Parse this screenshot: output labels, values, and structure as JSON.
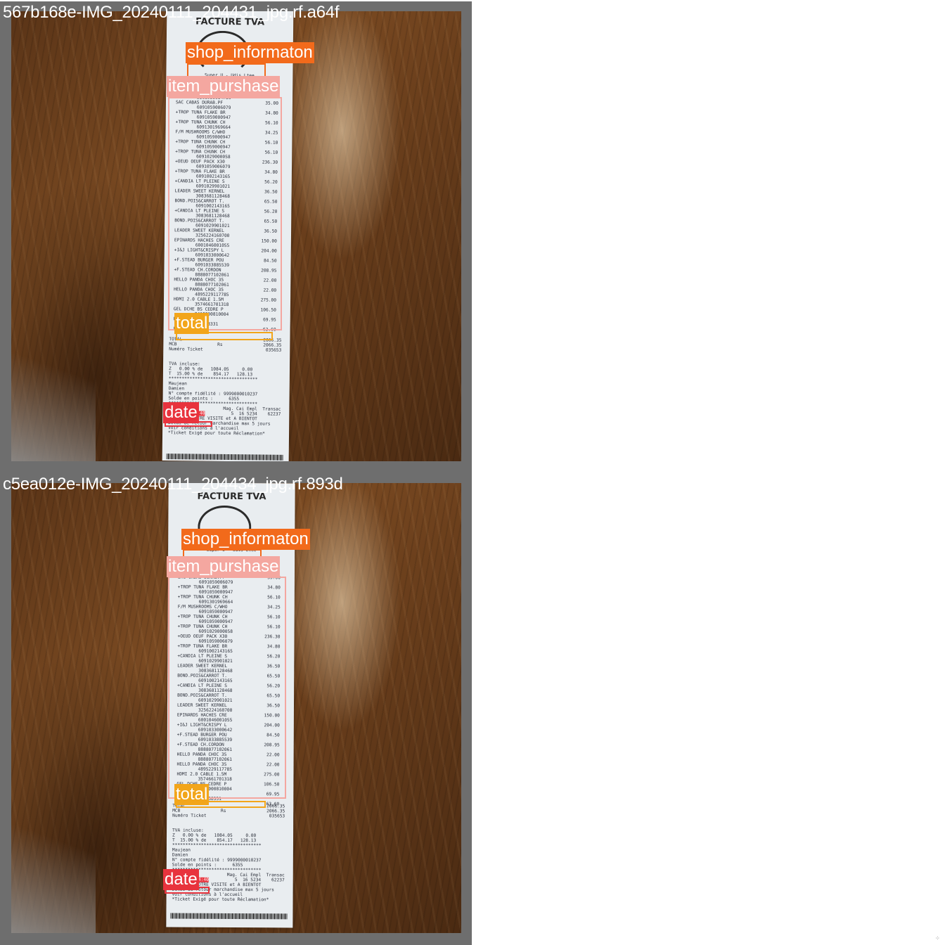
{
  "colors": {
    "shop_informaton": "#f26a1b",
    "item_purshase": "#f4a7a0",
    "total": "#f2a51a",
    "date": "#e8333d",
    "tile_border": "#6e6e6e"
  },
  "tiles": [
    {
      "caption": "567b168e-IMG_20240111_204431_jpg.rf.a64f",
      "boxes": {
        "shop_informaton": "shop_informaton",
        "item_purshase": "item_purshase",
        "total": "total",
        "date": "date"
      }
    },
    {
      "caption": "c5ea012e-IMG_20240111_204434_jpg.rf.893d",
      "boxes": {
        "shop_informaton": "shop_informaton",
        "item_purshase": "item_purshase",
        "total": "total",
        "date": "date"
      }
    }
  ],
  "receipt": {
    "title": "FACTURE TVA",
    "shop": "Super U - Udis Ltee",
    "items": [
      {
        "code": "3368950934736",
        "name": "",
        "price": ""
      },
      {
        "code": "",
        "name": "SAC CABAS DURAB.PF",
        "price": "35.00"
      },
      {
        "code": "6091059006079",
        "name": "",
        "price": ""
      },
      {
        "code": "",
        "name": "+TROP TUNA FLAKE BR",
        "price": "34.80"
      },
      {
        "code": "6091059000947",
        "name": "",
        "price": ""
      },
      {
        "code": "",
        "name": "+TROP TUNA CHUNK CH",
        "price": "56.10"
      },
      {
        "code": "6091301969664",
        "name": "",
        "price": ""
      },
      {
        "code": "",
        "name": "F/M MUSHROOMS C/WHO",
        "price": "34.25"
      },
      {
        "code": "6091059000947",
        "name": "",
        "price": ""
      },
      {
        "code": "",
        "name": "+TROP TUNA CHUNK CH",
        "price": "56.10"
      },
      {
        "code": "6091059000947",
        "name": "",
        "price": ""
      },
      {
        "code": "",
        "name": "+TROP TUNA CHUNK CH",
        "price": "56.10"
      },
      {
        "code": "6091029000058",
        "name": "",
        "price": ""
      },
      {
        "code": "",
        "name": "+OEUD OEUF PACK X30",
        "price": "236.30"
      },
      {
        "code": "6091059006079",
        "name": "",
        "price": ""
      },
      {
        "code": "",
        "name": "+TROP TUNA FLAKE BR",
        "price": "34.80"
      },
      {
        "code": "6091002143165",
        "name": "",
        "price": ""
      },
      {
        "code": "",
        "name": "+CANDIA LT PLEINE S",
        "price": "56.20"
      },
      {
        "code": "6091029901021",
        "name": "",
        "price": ""
      },
      {
        "code": "",
        "name": "LEADER SWEET KERNEL",
        "price": "36.50"
      },
      {
        "code": "3083681128468",
        "name": "",
        "price": ""
      },
      {
        "code": "",
        "name": "BOND.POIS&CARROT T.",
        "price": "65.50"
      },
      {
        "code": "6091002143165",
        "name": "",
        "price": ""
      },
      {
        "code": "",
        "name": "+CANDIA LT PLEINE S",
        "price": "56.20"
      },
      {
        "code": "3083681128468",
        "name": "",
        "price": ""
      },
      {
        "code": "",
        "name": "BOND.POIS&CARROT T.",
        "price": "65.50"
      },
      {
        "code": "6091029901021",
        "name": "",
        "price": ""
      },
      {
        "code": "",
        "name": "LEADER SWEET KERNEL",
        "price": "36.50"
      },
      {
        "code": "3256224160700",
        "name": "",
        "price": ""
      },
      {
        "code": "",
        "name": "EPINARDS HACHES CRE",
        "price": "150.00"
      },
      {
        "code": "6001046001055",
        "name": "",
        "price": ""
      },
      {
        "code": "",
        "name": "+I&J LIGHT&CRISPY L",
        "price": "204.00"
      },
      {
        "code": "6091033000642",
        "name": "",
        "price": ""
      },
      {
        "code": "",
        "name": "+F.STEAD BURGER POU",
        "price": "84.50"
      },
      {
        "code": "6091033885539",
        "name": "",
        "price": ""
      },
      {
        "code": "",
        "name": "+F.STEAD CH.CORDON",
        "price": "208.95"
      },
      {
        "code": "8888077102061",
        "name": "",
        "price": ""
      },
      {
        "code": "",
        "name": "HELLO PANDA CHOC 35",
        "price": "22.00"
      },
      {
        "code": "8888077102061",
        "name": "",
        "price": ""
      },
      {
        "code": "",
        "name": "HELLO PANDA CHOC 35",
        "price": "22.00"
      },
      {
        "code": "4895229117785",
        "name": "",
        "price": ""
      },
      {
        "code": "",
        "name": "HDMI 2.0 CABLE 1.5M",
        "price": "275.00"
      },
      {
        "code": "3574661701318",
        "name": "",
        "price": ""
      },
      {
        "code": "",
        "name": "GEL DCHE BS CEDRE P",
        "price": "106.50"
      },
      {
        "code": "8410000810004",
        "name": "",
        "price": ""
      },
      {
        "code": "",
        "name": "E POCK",
        "price": "69.95"
      },
      {
        "code": "760038331",
        "name": "",
        "price": ""
      },
      {
        "code": "",
        "name": "UETTE C",
        "price": "63.60"
      }
    ],
    "total_line": {
      "label": "TOTAL",
      "value": "2066.35"
    },
    "mcb_line": {
      "label": "MCB",
      "currency": "Rs",
      "value": "2066.35"
    },
    "ticket_line": {
      "label": "Numéro Ticket",
      "value": "035653"
    },
    "tva_title": "TVA incluse:",
    "tva_rows": [
      "Z   0.00 % de   1084.05     0.00",
      "T  15.00 % de    854.17   128.13"
    ],
    "stars": "**********************************",
    "customer": [
      "Maujean",
      "Damien"
    ],
    "account": "N° compte fidélité : 9999000010237",
    "points": "Solde en points :      6355",
    "store_header": "Mag. Cai Empl  Transac",
    "store_values": "5  16 5234    62237",
    "date_value": "09.01.24 14:40",
    "footer": [
      "MERCI DE VOTRE VISITE et A BIENTOT",
      "Délai de retour marchandise max 5 jours",
      "Voir conditions à l'accueil",
      "*Ticket Exigé pour toute Réclamation*"
    ],
    "barcode_digits": "66600501600622972024011914383"
  },
  "corner_mark": "⁘"
}
